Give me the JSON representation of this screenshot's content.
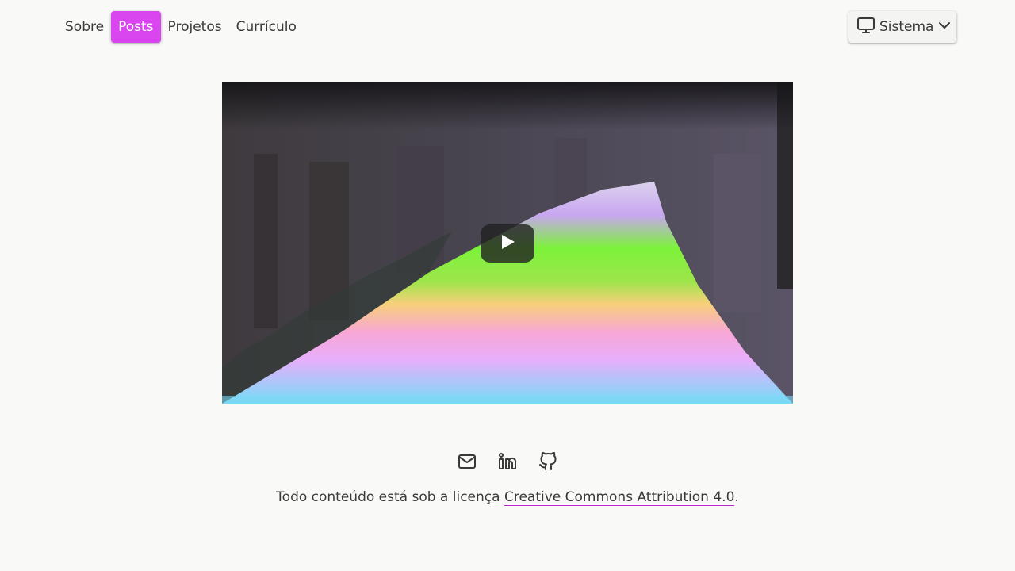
{
  "nav": {
    "items": [
      {
        "label": "Sobre"
      },
      {
        "label": "Posts",
        "active": true
      },
      {
        "label": "Projetos"
      },
      {
        "label": "Currículo"
      }
    ],
    "accent_color": "#d946ef"
  },
  "theme_selector": {
    "label": "Sistema",
    "icon": "monitor-icon"
  },
  "video": {
    "icon": "play-icon"
  },
  "socials": [
    {
      "icon": "mail-icon"
    },
    {
      "icon": "linkedin-icon"
    },
    {
      "icon": "github-icon"
    }
  ],
  "footer": {
    "text": "Todo conteúdo está sob a licença ",
    "link": "Creative Commons Attribution 4.0",
    "suffix": "."
  }
}
